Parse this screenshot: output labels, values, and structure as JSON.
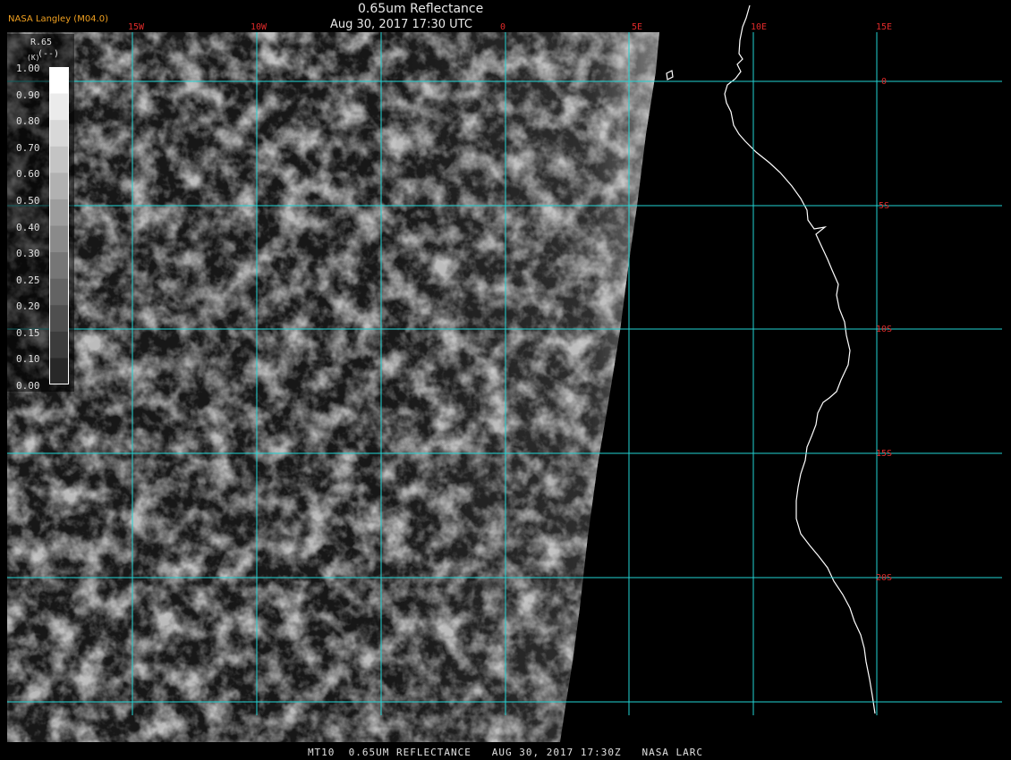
{
  "header": {
    "brand": "NASA Langley (M04.0)",
    "title": "0.65um Reflectance",
    "subtitle": "Aug 30, 2017 17:30 UTC"
  },
  "legend": {
    "variable": "R.65",
    "units": "(--)",
    "stray_glyph": "(K)",
    "ticks": [
      "1.00",
      "0.90",
      "0.80",
      "0.70",
      "0.60",
      "0.50",
      "0.40",
      "0.30",
      "0.25",
      "0.20",
      "0.15",
      "0.10",
      "0.00"
    ]
  },
  "grid": {
    "lon_labels": [
      "15W",
      "10W",
      "0",
      "5E",
      "10E",
      "15E"
    ],
    "lat_labels": [
      "0",
      "5S",
      "10S",
      "15S",
      "20S"
    ],
    "line_color": "#22d3d3",
    "label_color": "#e02a2a"
  },
  "footer": "MT10  0.65UM REFLECTANCE   AUG 30, 2017 17:30Z   NASA LARC",
  "colors": {
    "background": "#000000",
    "coastline": "#ffffff",
    "legend_frame": "#ffffff"
  }
}
